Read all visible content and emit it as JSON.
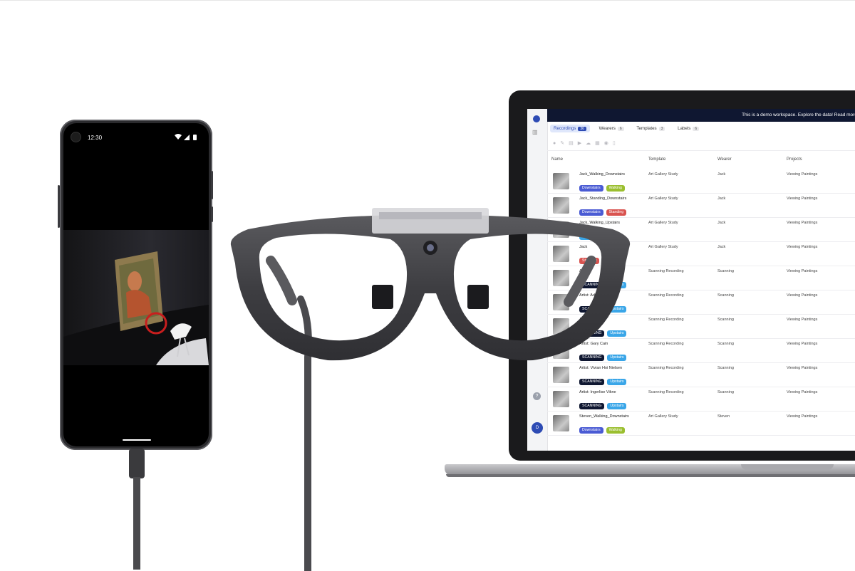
{
  "phone": {
    "time": "12:30"
  },
  "app": {
    "banner": "This is a demo workspace. Explore the data! Read more s",
    "tabs": [
      {
        "label": "Recordings",
        "count": "36"
      },
      {
        "label": "Wearers",
        "count": "6"
      },
      {
        "label": "Templates",
        "count": "3"
      },
      {
        "label": "Labels",
        "count": "6"
      }
    ],
    "avatar_initial": "D",
    "help": "?",
    "columns": {
      "name": "Name",
      "template": "Template",
      "wearer": "Wearer",
      "projects": "Projects"
    },
    "tag_colors": {
      "Downstairs": "#4a5bd4",
      "Walking": "#9bbf2f",
      "Standing": "#d9534f",
      "Upstairs": "#3aa6e8",
      "SCANNING": "#0f1731"
    },
    "rows": [
      {
        "name": "Jack_Walking_Downstairs",
        "tags": [
          "Downstairs",
          "Walking"
        ],
        "template": "Art Gallery Study",
        "wearer": "Jack",
        "project": "Viewing Paintings"
      },
      {
        "name": "Jack_Standing_Downstairs",
        "tags": [
          "Downstairs",
          "Standing"
        ],
        "template": "Art Gallery Study",
        "wearer": "Jack",
        "project": "Viewing Paintings"
      },
      {
        "name": "Jack_Walking_Upstairs",
        "tags": [
          "Upstairs",
          "Walking"
        ],
        "template": "Art Gallery Study",
        "wearer": "Jack",
        "project": "Viewing Paintings"
      },
      {
        "name": "Jack",
        "tags": [
          "Standing"
        ],
        "template": "Art Gallery Study",
        "wearer": "Jack",
        "project": "Viewing Paintings"
      },
      {
        "name": "Artist:",
        "tags": [
          "SCANNING",
          "Upstairs"
        ],
        "template": "Scanning Recording",
        "wearer": "Scanning",
        "project": "Viewing Paintings"
      },
      {
        "name": "Artist: Adel (3)",
        "tags": [
          "SCANNING",
          "Upstairs"
        ],
        "template": "Scanning Recording",
        "wearer": "Scanning",
        "project": "Viewing Paintings"
      },
      {
        "name": "Artist: wood (2)",
        "tags": [
          "SCANNING",
          "Upstairs"
        ],
        "template": "Scanning Recording",
        "wearer": "Scanning",
        "project": "Viewing Paintings"
      },
      {
        "name": "Artist: Gary Cain",
        "tags": [
          "SCANNING",
          "Upstairs"
        ],
        "template": "Scanning Recording",
        "wearer": "Scanning",
        "project": "Viewing Paintings"
      },
      {
        "name": "Artist: Vivian Hoi Nielsen",
        "tags": [
          "SCANNING",
          "Upstairs"
        ],
        "template": "Scanning Recording",
        "wearer": "Scanning",
        "project": "Viewing Paintings"
      },
      {
        "name": "Artist: Ingerlise Vikne",
        "tags": [
          "SCANNING",
          "Upstairs"
        ],
        "template": "Scanning Recording",
        "wearer": "Scanning",
        "project": "Viewing Paintings"
      },
      {
        "name": "Steven_Walking_Downstairs",
        "tags": [
          "Downstairs",
          "Walking"
        ],
        "template": "Art Gallery Study",
        "wearer": "Steven",
        "project": "Viewing Paintings"
      }
    ]
  }
}
